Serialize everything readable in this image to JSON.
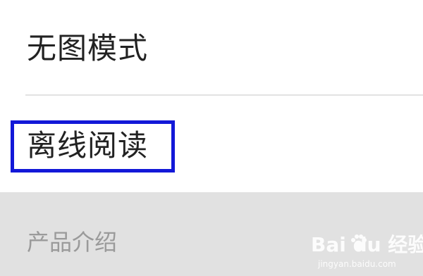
{
  "settings_menu": {
    "items": [
      {
        "label": "无图模式"
      },
      {
        "label": "离线阅读",
        "highlighted": true
      }
    ],
    "section_header": {
      "label": "产品介绍"
    }
  },
  "watermark": {
    "brand": "Bai du 经验",
    "url": "jingyan.baidu.com"
  },
  "colors": {
    "highlight_border": "#1218d8",
    "section_bg": "#e1e1e1",
    "text_primary": "#222222",
    "text_muted": "#9a9a9a"
  }
}
